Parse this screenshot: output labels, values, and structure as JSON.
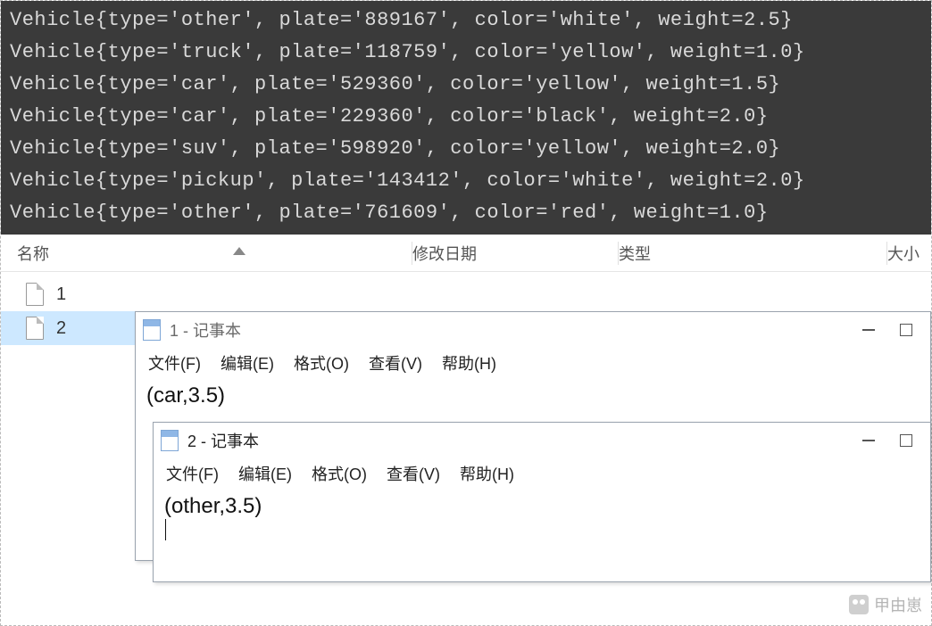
{
  "console": {
    "lines": [
      "Vehicle{type='other', plate='889167', color='white', weight=2.5}",
      "Vehicle{type='truck', plate='118759', color='yellow', weight=1.0}",
      "Vehicle{type='car', plate='529360', color='yellow', weight=1.5}",
      "Vehicle{type='car', plate='229360', color='black', weight=2.0}",
      "Vehicle{type='suv', plate='598920', color='yellow', weight=2.0}",
      "Vehicle{type='pickup', plate='143412', color='white', weight=2.0}",
      "Vehicle{type='other', plate='761609', color='red', weight=1.0}"
    ]
  },
  "explorer": {
    "columns": {
      "name": "名称",
      "modified": "修改日期",
      "type": "类型",
      "size": "大小"
    },
    "files": [
      {
        "name": "1",
        "selected": false
      },
      {
        "name": "2",
        "selected": true
      }
    ]
  },
  "notepad1": {
    "title": "1 - 记事本",
    "menu": {
      "file": "文件(F)",
      "edit": "编辑(E)",
      "format": "格式(O)",
      "view": "查看(V)",
      "help": "帮助(H)"
    },
    "content": "(car,3.5)"
  },
  "notepad2": {
    "title": "2 - 记事本",
    "menu": {
      "file": "文件(F)",
      "edit": "编辑(E)",
      "format": "格式(O)",
      "view": "查看(V)",
      "help": "帮助(H)"
    },
    "content": "(other,3.5)"
  },
  "watermark": "甲由崽"
}
